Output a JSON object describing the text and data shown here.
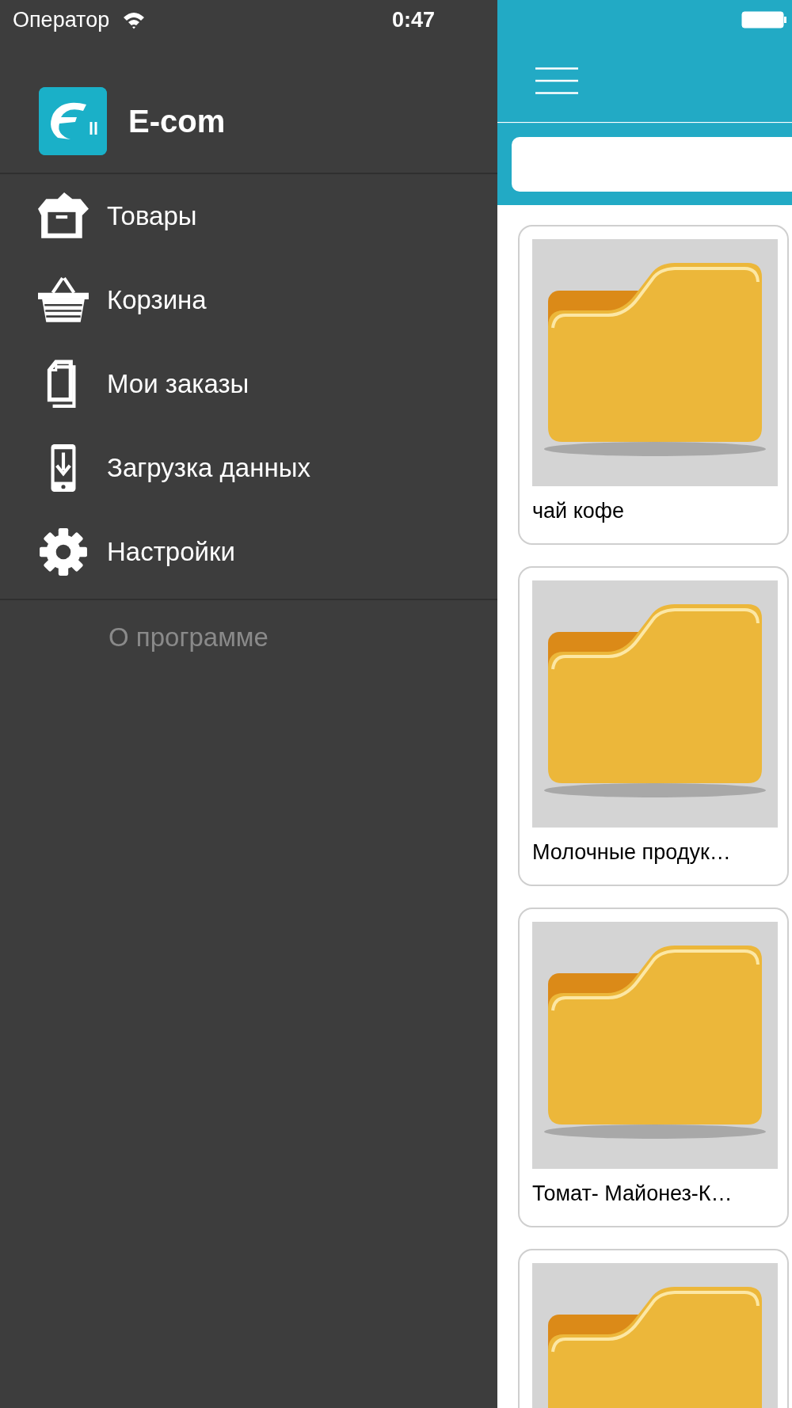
{
  "status_bar": {
    "carrier": "Оператор",
    "time": "0:47"
  },
  "sidebar": {
    "app_title": "E-com",
    "items": [
      {
        "label": "Товары"
      },
      {
        "label": "Корзина"
      },
      {
        "label": "Мои заказы"
      },
      {
        "label": "Загрузка данных"
      },
      {
        "label": "Настройки"
      }
    ],
    "about": "О программе"
  },
  "categories": [
    {
      "kind": "folder",
      "label": "чай кофе"
    },
    {
      "kind": "folder",
      "label": "Молочные продук…"
    },
    {
      "kind": "folder",
      "label": "Томат- Майонез-К…"
    },
    {
      "kind": "folder"
    }
  ]
}
